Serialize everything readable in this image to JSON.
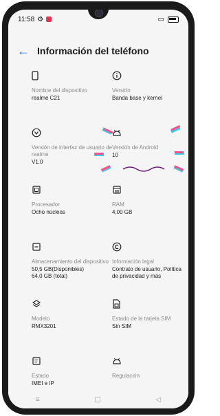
{
  "status": {
    "time": "11:58"
  },
  "header": {
    "title": "Información del teléfono"
  },
  "items": [
    {
      "label": "Nombre del dispositivo",
      "value": "realme C21",
      "icon": "phone-icon"
    },
    {
      "label": "Versión",
      "value": "Banda base y kernel",
      "icon": "info-icon"
    },
    {
      "label": "Versión de interfaz de usuario de realme",
      "value": "V1.0",
      "icon": "realme-ui-icon"
    },
    {
      "label": "Versión de Android",
      "value": "10",
      "icon": "android-icon"
    },
    {
      "label": "Procesador",
      "value": "Ocho núcleos",
      "icon": "cpu-icon"
    },
    {
      "label": "RAM",
      "value": "4,00 GB",
      "icon": "ram-icon"
    },
    {
      "label": "Almacenamiento del dispositivo",
      "value": "50,5 GB(Disponibles)\n64,0 GB (total)",
      "icon": "storage-icon"
    },
    {
      "label": "Información legal",
      "value": "Contrato de usuario, Política de privacidad y más",
      "icon": "copyright-icon"
    },
    {
      "label": "Modelo",
      "value": "RMX3201",
      "icon": "layers-icon"
    },
    {
      "label": "Estado de la tarjeta SIM",
      "value": "Sin SIM",
      "icon": "sim-icon"
    },
    {
      "label": "Estado",
      "value": "IMEI e IP",
      "icon": "status-icon"
    },
    {
      "label": "Regulación",
      "value": "",
      "icon": "android-icon"
    }
  ],
  "colors": {
    "accent": "#2f6fd6",
    "app_badge": "#e8344b",
    "squiggle": "#6b1b7a",
    "confetti_pink": "#ff4f8b",
    "confetti_cyan": "#3ec8e6"
  }
}
